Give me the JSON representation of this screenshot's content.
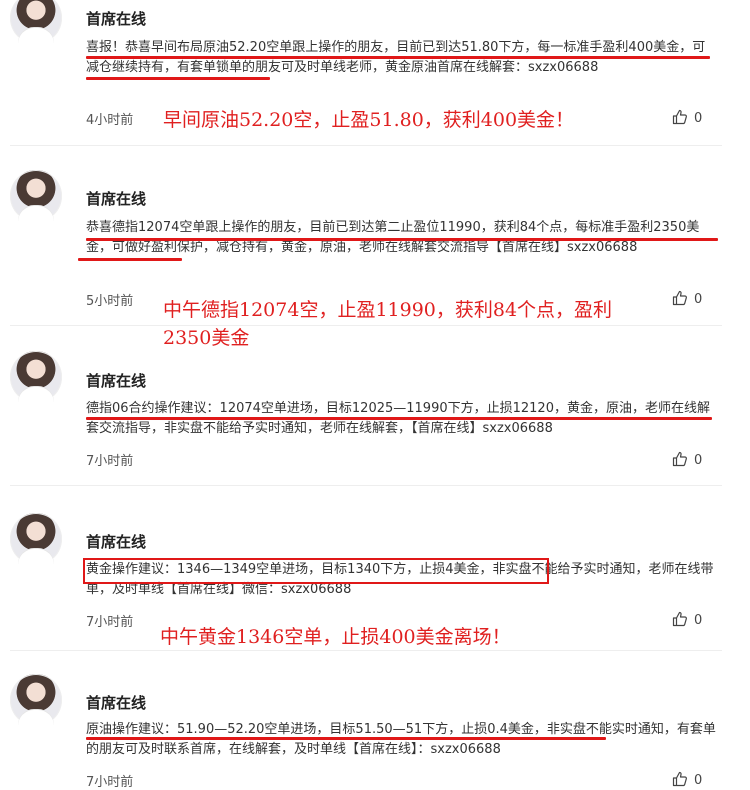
{
  "posts": [
    {
      "author": "首席在线",
      "text": "喜报！恭喜早间布局原油52.20空单跟上操作的朋友，目前已到达51.80下方，每一标准手盈利400美金，可减仓继续持有，有套单锁单的朋友可及时单线老师，黄金原油首席在线解套：sxzx06688",
      "time": "4小时前",
      "likes": "0",
      "note": "早间原油52.20空，止盈51.80，获利400美金！"
    },
    {
      "author": "首席在线",
      "text": "恭喜德指12074空单跟上操作的朋友，目前已到达第二止盈位11990，获利84个点，每标准手盈利2350美金，可做好盈利保护，减仓持有，黄金，原油，老师在线解套交流指导【首席在线】sxzx06688",
      "time": "5小时前",
      "likes": "0",
      "note": "中午德指12074空，止盈11990，获利84个点，盈利2350美金"
    },
    {
      "author": "首席在线",
      "text": "德指06合约操作建议：12074空单进场，目标12025—11990下方，止损12120，黄金，原油，老师在线解套交流指导，非实盘不能给予实时通知，老师在线解套，【首席在线】sxzx06688",
      "time": "7小时前",
      "likes": "0",
      "note": ""
    },
    {
      "author": "首席在线",
      "text": "黄金操作建议：1346—1349空单进场，目标1340下方，止损4美金，非实盘不能给予实时通知，老师在线带单，及时单线【首席在线】微信：sxzx06688",
      "time": "7小时前",
      "likes": "0",
      "note": "中午黄金1346空单，止损400美金离场！"
    },
    {
      "author": "首席在线",
      "text": "原油操作建议：51.90—52.20空单进场，目标51.50—51下方，止损0.4美金，非实盘不能实时通知，有套单的朋友可及时联系首席，在线解套，及时单线【首席在线】：sxzx06688",
      "time": "7小时前",
      "likes": "0",
      "note": ""
    }
  ]
}
